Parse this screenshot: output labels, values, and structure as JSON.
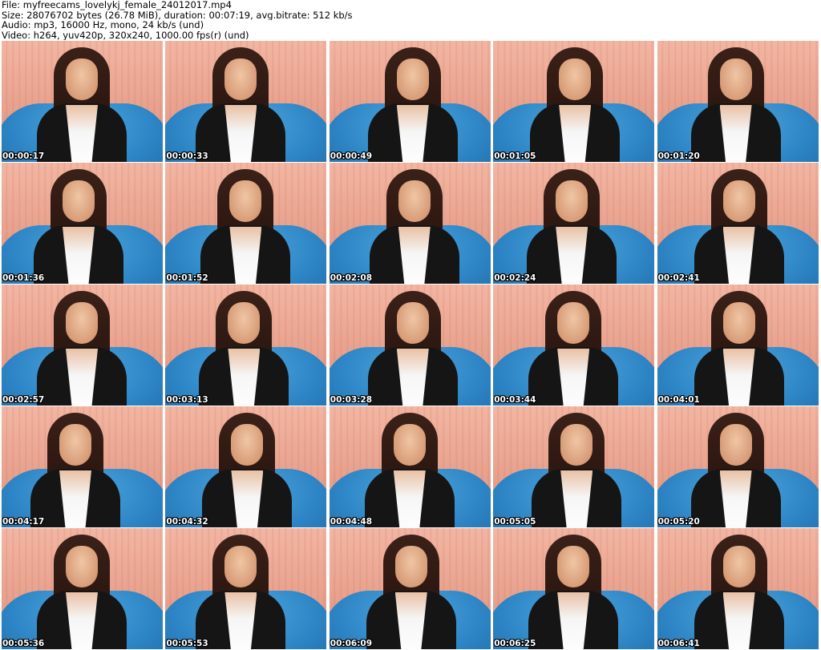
{
  "header": {
    "file": "File: myfreecams_lovelykj_female_24012017.mp4",
    "size": "Size: 28076702 bytes (26.78 MiB), duration: 00:07:19, avg.bitrate: 512 kb/s",
    "audio": "Audio: mp3, 16000 Hz, mono, 24 kb/s (und)",
    "video": "Video: h264, yuv420p, 320x240, 1000.00 fps(r) (und)"
  },
  "grid": {
    "columns": 5,
    "rows": 5,
    "timestamps": [
      "00:00:17",
      "00:00:33",
      "00:00:49",
      "00:01:05",
      "00:01:20",
      "00:01:36",
      "00:01:52",
      "00:02:08",
      "00:02:24",
      "00:02:41",
      "00:02:57",
      "00:03:13",
      "00:03:28",
      "00:03:44",
      "00:04:01",
      "00:04:17",
      "00:04:32",
      "00:04:48",
      "00:05:05",
      "00:05:20",
      "00:05:36",
      "00:05:53",
      "00:06:09",
      "00:06:25",
      "00:06:41"
    ]
  },
  "colors": {
    "background": "#ffffff",
    "curtain": "#e9a896",
    "chair": "#2e86c6",
    "hair": "#2a1510",
    "top": "#151515",
    "timestamp_text": "#ffffff"
  }
}
